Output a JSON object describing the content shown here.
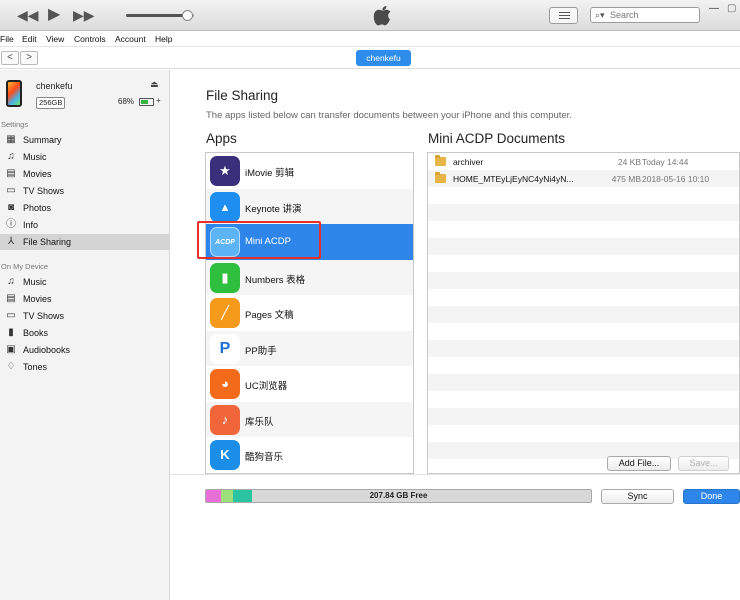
{
  "toolbar": {
    "prev": "◀◀",
    "play": "▶",
    "next": "▶▶",
    "volume_fraction": 0.9,
    "search_placeholder": "Search",
    "min": "—",
    "max": "▢",
    "close": "✕"
  },
  "menu": [
    "File",
    "Edit",
    "View",
    "Controls",
    "Account",
    "Help"
  ],
  "nav": {
    "back": "<",
    "forward": ">",
    "device_pill": "chenkefu"
  },
  "device": {
    "name": "chenkefu",
    "capacity": "256GB",
    "battery": "68%",
    "battery_fraction": 0.68
  },
  "sidebar": {
    "settings_head": "Settings",
    "settings": [
      {
        "label": "Summary",
        "icon": "summary-icon",
        "glyph": "▦"
      },
      {
        "label": "Music",
        "icon": "music-icon",
        "glyph": "♫"
      },
      {
        "label": "Movies",
        "icon": "movies-icon",
        "glyph": "▤"
      },
      {
        "label": "TV Shows",
        "icon": "tv-icon",
        "glyph": "▭"
      },
      {
        "label": "Photos",
        "icon": "camera-icon",
        "glyph": "◙"
      },
      {
        "label": "Info",
        "icon": "info-icon",
        "glyph": "ⓘ"
      },
      {
        "label": "File Sharing",
        "icon": "file-sharing-icon",
        "glyph": "⅄"
      }
    ],
    "selected": "File Sharing",
    "device_head": "On My Device",
    "device_items": [
      {
        "label": "Music",
        "icon": "music-icon",
        "glyph": "♫"
      },
      {
        "label": "Movies",
        "icon": "movies-icon",
        "glyph": "▤"
      },
      {
        "label": "TV Shows",
        "icon": "tv-icon",
        "glyph": "▭"
      },
      {
        "label": "Books",
        "icon": "books-icon",
        "glyph": "▮"
      },
      {
        "label": "Audiobooks",
        "icon": "audiobooks-icon",
        "glyph": "▣"
      },
      {
        "label": "Tones",
        "icon": "bell-icon",
        "glyph": "♢"
      }
    ]
  },
  "main": {
    "title": "File Sharing",
    "subtitle": "The apps listed below can transfer documents between your iPhone and this computer.",
    "apps_head": "Apps",
    "docs_head": "Mini ACDP Documents"
  },
  "apps": [
    {
      "label": "iMovie 剪辑",
      "icon": "imovie-icon",
      "glyph": "★",
      "bg": "#3a2f7a"
    },
    {
      "label": "Keynote 讲演",
      "icon": "keynote-icon",
      "glyph": "▴",
      "bg": "#1e8ff0"
    },
    {
      "label": "Mini ACDP",
      "icon": "mini-acdp-icon",
      "glyph": "ACDP",
      "bg": "#5cb3f5"
    },
    {
      "label": "Numbers 表格",
      "icon": "numbers-icon",
      "glyph": "▮",
      "bg": "#2fbf3f"
    },
    {
      "label": "Pages 文稿",
      "icon": "pages-icon",
      "glyph": "╱",
      "bg": "#f59a1a"
    },
    {
      "label": "PP助手",
      "icon": "pp-icon",
      "glyph": "P",
      "bg": "#ffffff"
    },
    {
      "label": "UC浏览器",
      "icon": "uc-browser-icon",
      "glyph": "◕",
      "bg": "#f26a1a"
    },
    {
      "label": "库乐队",
      "icon": "garageband-icon",
      "glyph": "♪",
      "bg": "#f0663a"
    },
    {
      "label": "酷狗音乐",
      "icon": "kugou-icon",
      "glyph": "K",
      "bg": "#1b8fe8"
    }
  ],
  "selected_app": "Mini ACDP",
  "documents": [
    {
      "name": "archiver",
      "size": "24 KB",
      "date": "Today 14:44"
    },
    {
      "name": "HOME_MTEyLjEyNC4yNi4yN...",
      "size": "475 MB",
      "date": "2018-05-16 10:10"
    }
  ],
  "buttons": {
    "add_file": "Add File...",
    "save": "Save...",
    "sync": "Sync",
    "done": "Done"
  },
  "storage": {
    "free_label": "207.84 GB Free",
    "segments": [
      {
        "color": "#e86fd8",
        "fraction": 0.04
      },
      {
        "color": "#9be07a",
        "fraction": 0.03
      },
      {
        "color": "#2bc4a0",
        "fraction": 0.05
      }
    ]
  },
  "colors": {
    "accent": "#2f86ea",
    "highlight_box": "#e8302b"
  }
}
